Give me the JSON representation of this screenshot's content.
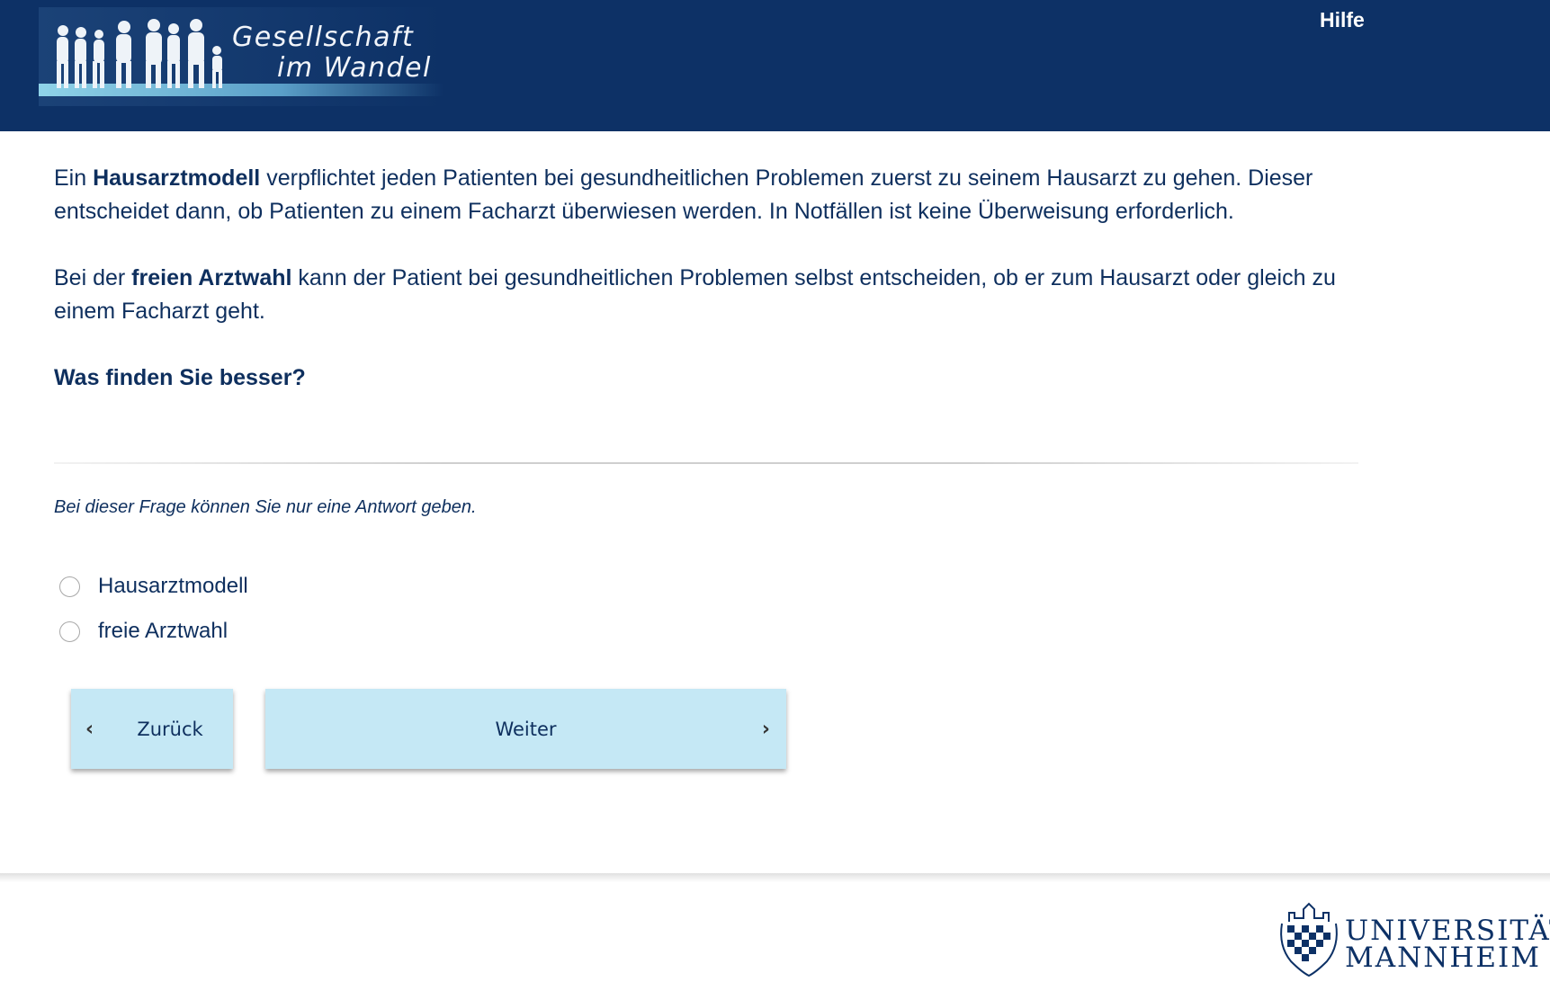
{
  "header": {
    "logo_line1": "Gesellschaft",
    "logo_line2": "im Wandel",
    "help_label": "Hilfe",
    "background_color": "#0d3166"
  },
  "main": {
    "para1": {
      "prefix": "Ein ",
      "bold": "Hausarztmodell",
      "rest": " verpflichtet jeden Patienten bei gesundheitlichen Problemen zuerst zu seinem Hausarzt zu gehen. Dieser entscheidet dann, ob Patienten zu einem Facharzt überwiesen werden. In Notfällen ist keine Überweisung erforderlich."
    },
    "para2": {
      "prefix": "Bei der ",
      "bold": "freien Arztwahl",
      "rest": " kann der Patient bei gesundheitlichen Problemen selbst entscheiden, ob er zum Hausarzt oder gleich zu einem Facharzt geht."
    },
    "question": "Was finden Sie besser?",
    "hint": "Bei dieser Frage können Sie nur eine Antwort geben.",
    "options": [
      {
        "label": "Hausarztmodell",
        "selected": false
      },
      {
        "label": "freie Arztwahl",
        "selected": false
      }
    ]
  },
  "nav": {
    "back_label": "Zurück",
    "next_label": "Weiter",
    "button_color": "#c5e8f5",
    "back_icon": "chevron-left-icon",
    "next_icon": "chevron-right-icon"
  },
  "footer": {
    "uni_line1": "UNIVERSITÄT",
    "uni_line2": "MANNHEIM"
  }
}
